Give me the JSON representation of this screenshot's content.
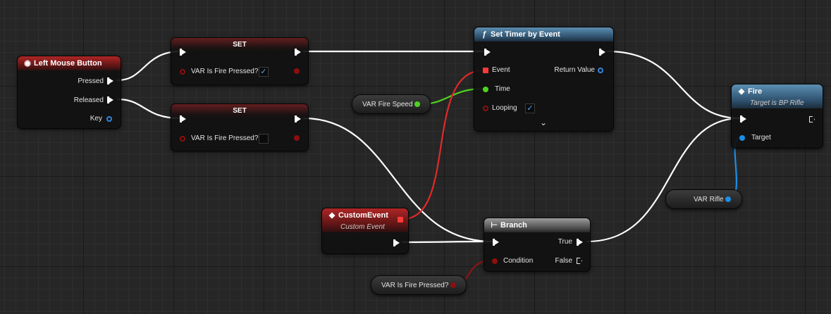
{
  "nodes": {
    "left_mouse": {
      "title": "Left Mouse Button",
      "icon": "mouse-icon",
      "pressed": "Pressed",
      "released": "Released",
      "key": "Key"
    },
    "set1": {
      "title": "SET",
      "var_label": "VAR Is Fire Pressed?",
      "checked": true
    },
    "set2": {
      "title": "SET",
      "var_label": "VAR Is Fire Pressed?",
      "checked": false
    },
    "set_timer": {
      "title": "Set Timer by Event",
      "icon": "function-icon",
      "event": "Event",
      "return_value": "Return Value",
      "time": "Time",
      "looping": "Looping",
      "looping_checked": true
    },
    "fire_speed": {
      "label": "VAR Fire Speed"
    },
    "fire": {
      "title": "Fire",
      "subtitle": "Target is BP Rifle",
      "icon": "event-icon",
      "target": "Target"
    },
    "rifle": {
      "label": "VAR Rifle"
    },
    "custom_event": {
      "title": "CustomEvent",
      "subtitle": "Custom Event",
      "icon": "event-icon"
    },
    "branch": {
      "title": "Branch",
      "icon": "branch-icon",
      "true_label": "True",
      "condition": "Condition",
      "false_label": "False"
    },
    "fire_pressed": {
      "label": "VAR Is Fire Pressed?"
    }
  },
  "colors": {
    "exec": "#ffffff",
    "bool": "#8c0f0f",
    "float": "#4ed321",
    "object": "#1c8ee6",
    "delegate": "#ff3a3a"
  }
}
